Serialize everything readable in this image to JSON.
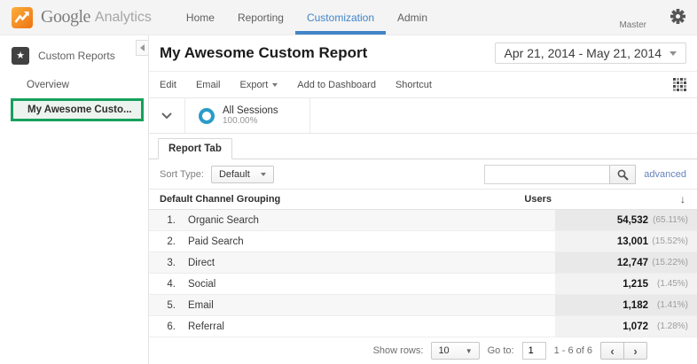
{
  "colors": {
    "accent_blue": "#4285c8",
    "highlight_green": "#16a05d",
    "segment_ring_blue": "#2b9bc7",
    "link_blue": "#6583bd",
    "logo_orange": "#ef7211"
  },
  "nav": {
    "logo_brand": "Google",
    "logo_product": "Analytics",
    "items": [
      {
        "label": "Home",
        "active": false
      },
      {
        "label": "Reporting",
        "active": false
      },
      {
        "label": "Customization",
        "active": true
      },
      {
        "label": "Admin",
        "active": false
      }
    ],
    "account": "Master"
  },
  "sidebar": {
    "section_label": "Custom Reports",
    "items": [
      {
        "label": "Overview",
        "selected": false
      },
      {
        "label": "My Awesome Custo...",
        "selected": true
      }
    ]
  },
  "header": {
    "title": "My Awesome Custom Report",
    "date_range": "Apr 21, 2014 - May 21, 2014"
  },
  "toolbar": {
    "actions": [
      "Edit",
      "Email",
      "Export",
      "Add to Dashboard",
      "Shortcut"
    ]
  },
  "segment": {
    "name": "All Sessions",
    "percent": "100.00%"
  },
  "tabs": [
    {
      "label": "Report Tab",
      "active": true
    }
  ],
  "controls": {
    "sort_label": "Sort Type:",
    "sort_value": "Default",
    "search_placeholder": "",
    "advanced_label": "advanced"
  },
  "table": {
    "columns": [
      "Default Channel Grouping",
      "Users"
    ],
    "rows": [
      {
        "rank": "1.",
        "channel": "Organic Search",
        "users": "54,532",
        "percent": "(65.11%)"
      },
      {
        "rank": "2.",
        "channel": "Paid Search",
        "users": "13,001",
        "percent": "(15.52%)"
      },
      {
        "rank": "3.",
        "channel": "Direct",
        "users": "12,747",
        "percent": "(15.22%)"
      },
      {
        "rank": "4.",
        "channel": "Social",
        "users": "1,215",
        "percent": "(1.45%)"
      },
      {
        "rank": "5.",
        "channel": "Email",
        "users": "1,182",
        "percent": "(1.41%)"
      },
      {
        "rank": "6.",
        "channel": "Referral",
        "users": "1,072",
        "percent": "(1.28%)"
      }
    ]
  },
  "footer": {
    "show_rows_label": "Show rows:",
    "show_rows_value": "10",
    "goto_label": "Go to:",
    "goto_value": "1",
    "range": "1 - 6 of 6",
    "prev": "‹",
    "next": "›"
  },
  "icons": {
    "star": "★",
    "sort_direction": "↓"
  }
}
